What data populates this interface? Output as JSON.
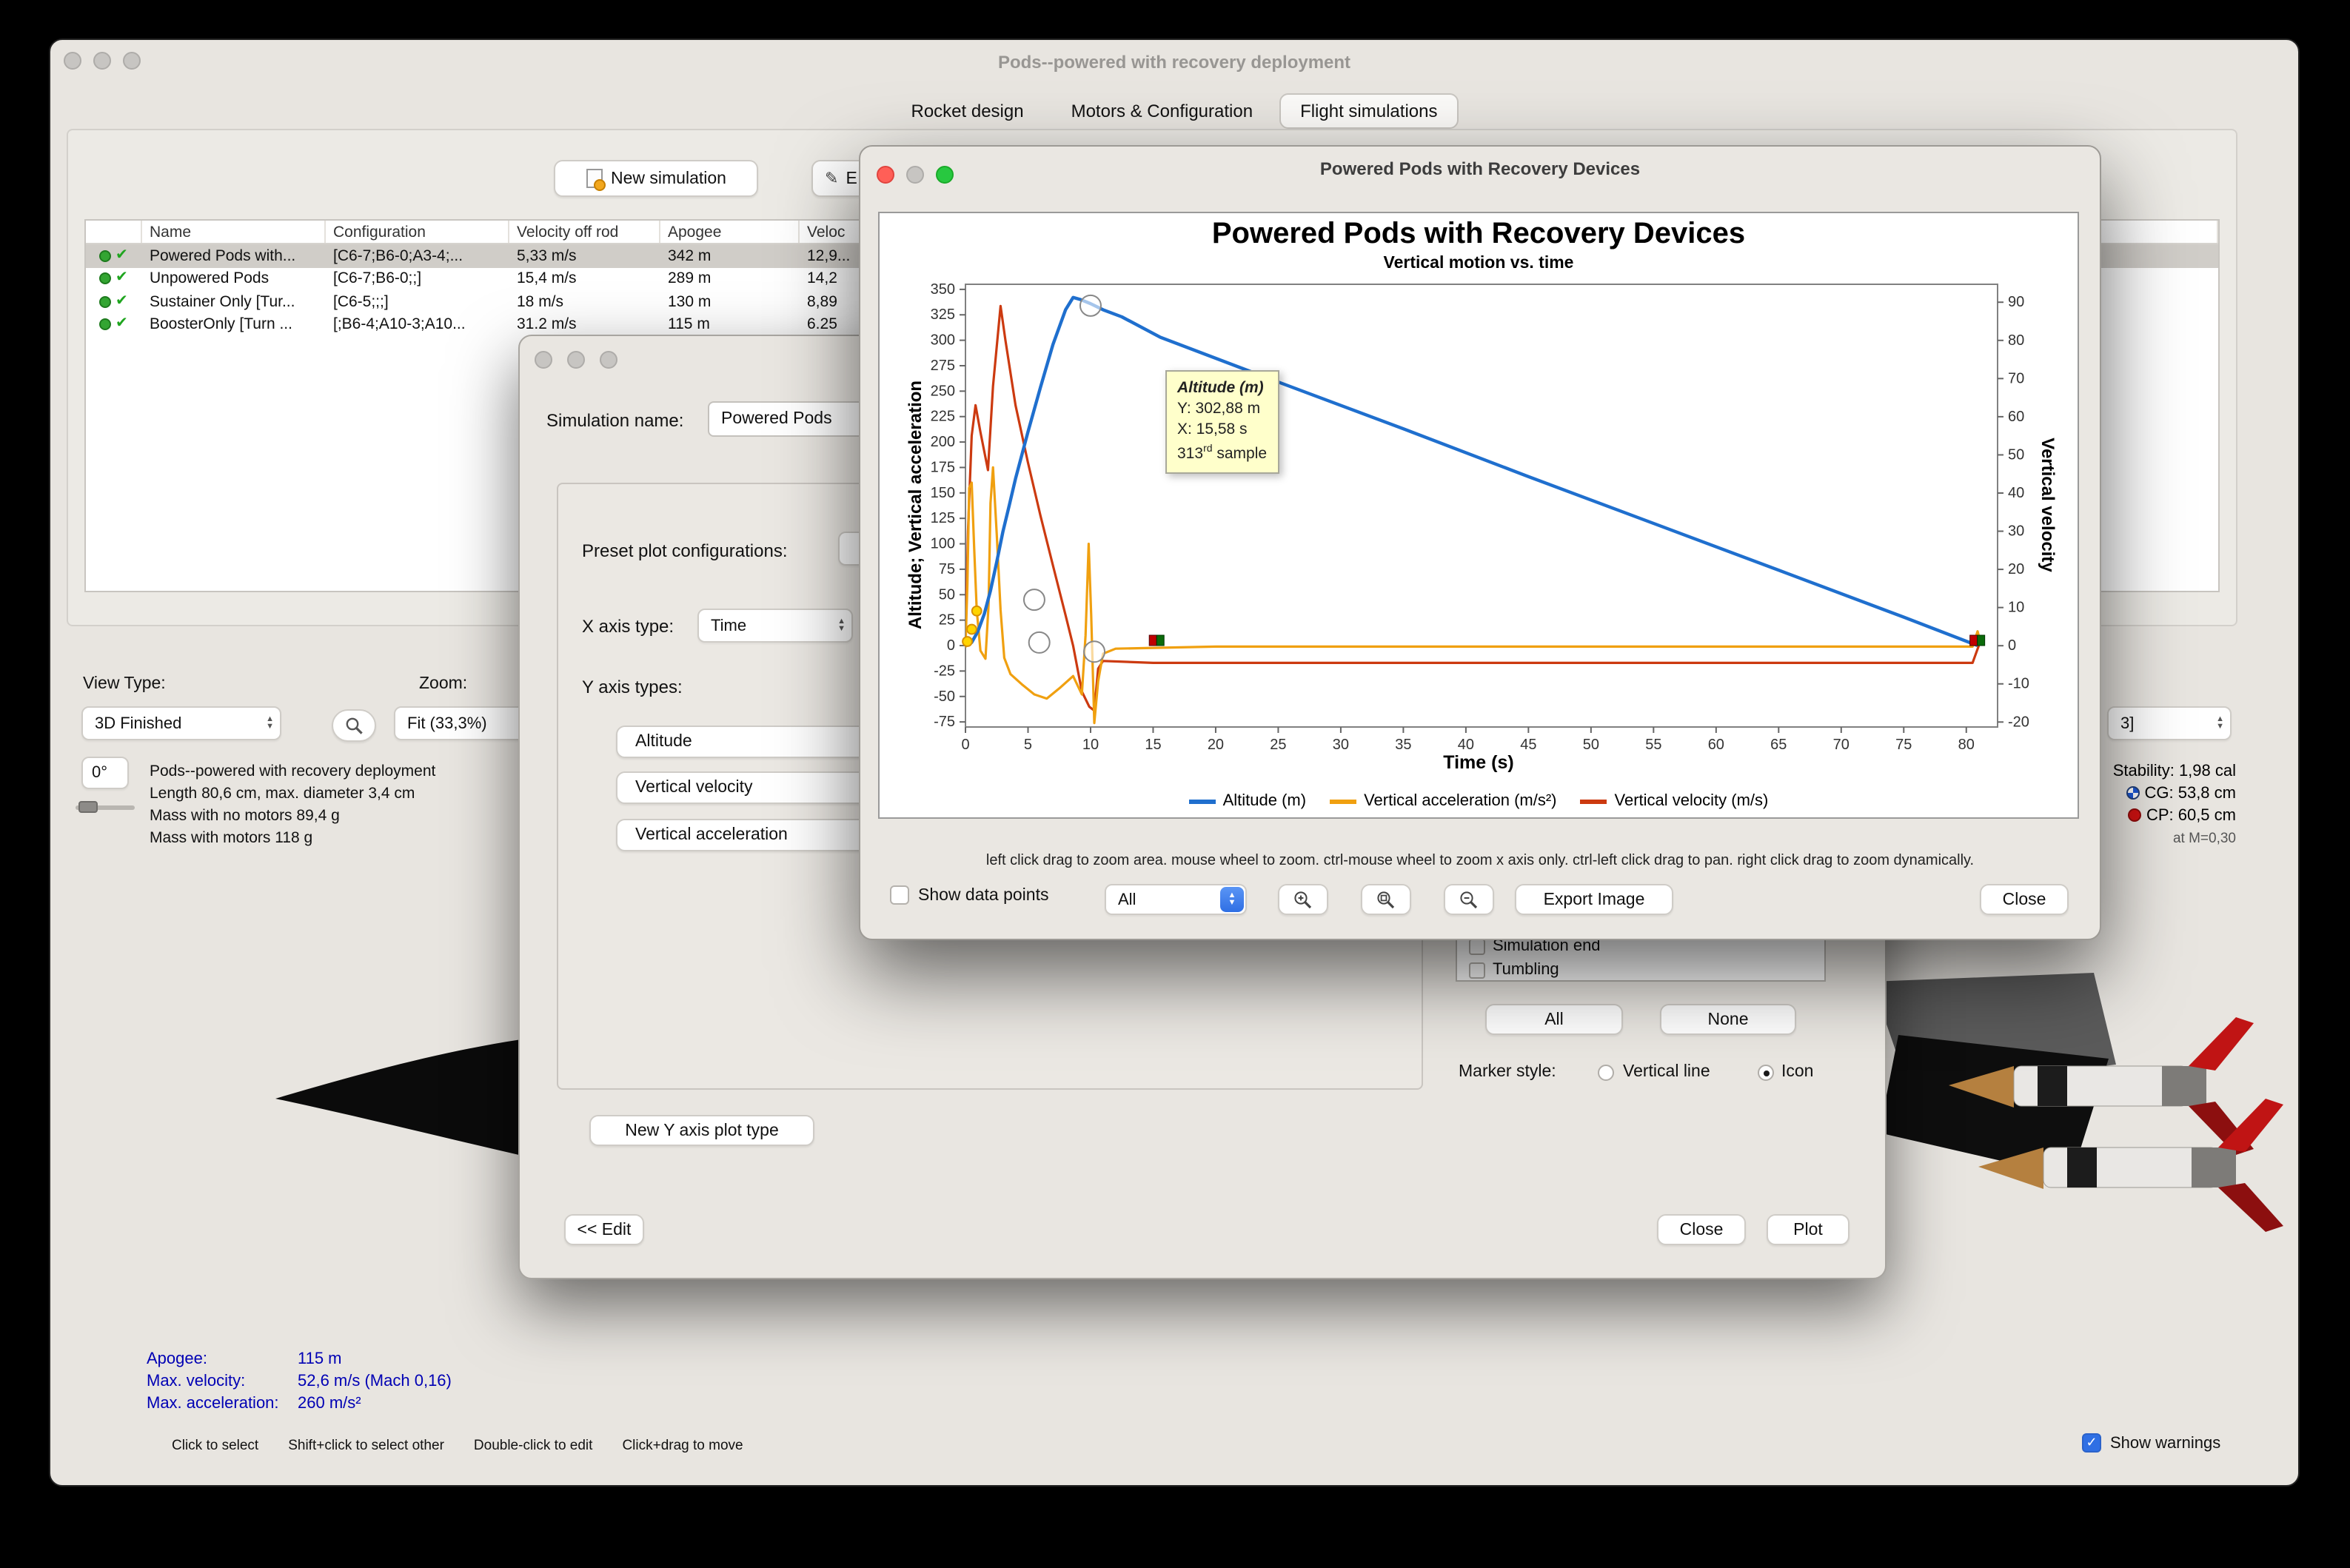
{
  "accent_colors": {
    "macos_blue": "#2f6fe4",
    "selection_gray": "#d0cdc8"
  },
  "main_window": {
    "title": "Pods--powered with recovery deployment",
    "tabs": [
      {
        "label": "Rocket design"
      },
      {
        "label": "Motors & Configuration"
      },
      {
        "label": "Flight simulations"
      }
    ],
    "toolbar": {
      "new_simulation": "New simulation",
      "edit_partial": "E"
    },
    "table": {
      "columns": [
        "Name",
        "Configuration",
        "Velocity off rod",
        "Apogee",
        "Veloc"
      ],
      "rows": [
        {
          "name": "Powered Pods with...",
          "configuration": "[C6-7;B6-0;A3-4;...",
          "velocity_off_rod": "5,33 m/s",
          "apogee": "342 m",
          "velocity_deployment": "12,9..."
        },
        {
          "name": "Unpowered Pods",
          "configuration": "[C6-7;B6-0;;]",
          "velocity_off_rod": "15,4 m/s",
          "apogee": "289 m",
          "velocity_deployment": "14,2"
        },
        {
          "name": "Sustainer Only [Tur...",
          "configuration": "[C6-5;;;]",
          "velocity_off_rod": "18 m/s",
          "apogee": "130 m",
          "velocity_deployment": "8,89"
        },
        {
          "name": "BoosterOnly [Turn ...",
          "configuration": "[;B6-4;A10-3;A10...",
          "velocity_off_rod": "31.2 m/s",
          "apogee": "115 m",
          "velocity_deployment": "6.25"
        }
      ]
    },
    "view_controls": {
      "view_type_label": "View Type:",
      "view_type_value": "3D Finished",
      "zoom_label": "Zoom:",
      "zoom_value": "Fit (33,3%)",
      "angle_value": "0°"
    },
    "rocket_info": [
      "Pods--powered with recovery deployment",
      "Length 80,6 cm, max. diameter 3,4 cm",
      "Mass with no motors 89,4 g",
      "Mass with motors 118 g"
    ],
    "config_selector_value": "3]",
    "stability": {
      "stability": "Stability: 1,98 cal",
      "cg": "CG: 53,8 cm",
      "cp": "CP: 60,5 cm",
      "mach": "at M=0,30"
    },
    "flight_stats": [
      {
        "label": "Apogee:",
        "value": "115 m"
      },
      {
        "label": "Max. velocity:",
        "value": "52,6 m/s  (Mach 0,16)"
      },
      {
        "label": "Max. acceleration:",
        "value": "260 m/s²"
      }
    ],
    "status_hints": [
      "Click to select",
      "Shift+click to select other",
      "Double-click to edit",
      "Click+drag to move"
    ],
    "show_warnings_label": "Show warnings"
  },
  "edit_dialog": {
    "simulation_name_label": "Simulation name:",
    "simulation_name_value": "Powered Pods",
    "preset_label": "Preset plot configurations:",
    "x_axis_label": "X axis type:",
    "x_axis_value": "Time",
    "y_axis_label": "Y axis types:",
    "y_axis_types": [
      "Altitude",
      "Vertical velocity",
      "Vertical acceleration"
    ],
    "new_y_axis_button": "New Y axis plot type",
    "edit_button": "<< Edit",
    "close_button": "Close",
    "plot_button": "Plot",
    "event_items": [
      "Simulation end",
      "Tumbling"
    ],
    "all_button": "All",
    "none_button": "None",
    "marker_style_label": "Marker style:",
    "marker_vertical_line": "Vertical line",
    "marker_icon": "Icon"
  },
  "plot_dialog": {
    "title": "Powered Pods with Recovery Devices",
    "help_text": "left click drag to zoom area. mouse wheel to zoom. ctrl-mouse wheel to zoom x axis only. ctrl-left click drag to pan.  right click drag to zoom dynamically.",
    "show_data_points_label": "Show data points",
    "branch_value": "All",
    "export_button": "Export Image",
    "close_button": "Close",
    "tooltip": {
      "series": "Altitude (m)",
      "y_text": "Y: 302,88 m",
      "x_text": "X: 15,58 s",
      "sample_number": "313",
      "sample_ordinal": "rd",
      "sample_word": " sample"
    }
  },
  "chart_data": {
    "type": "line",
    "title": "Powered Pods with Recovery Devices",
    "subtitle": "Vertical motion vs. time",
    "xlabel": "Time (s)",
    "ylabel_left": "Altitude; Vertical acceleration",
    "ylabel_right": "Vertical velocity",
    "x_axis": {
      "min": 0,
      "max": 82.5,
      "ticks": [
        0,
        5,
        10,
        15,
        20,
        25,
        30,
        35,
        40,
        45,
        50,
        55,
        60,
        65,
        70,
        75,
        80
      ]
    },
    "left_axis": {
      "min": -80,
      "max": 355,
      "ticks": [
        -75,
        -50,
        -25,
        0,
        25,
        50,
        75,
        100,
        125,
        150,
        175,
        200,
        225,
        250,
        275,
        300,
        325,
        350
      ]
    },
    "right_axis": {
      "min": -21.3,
      "max": 94.7,
      "ticks": [
        -20,
        -10,
        0,
        10,
        20,
        30,
        40,
        50,
        60,
        70,
        80,
        90
      ]
    },
    "series": [
      {
        "name": "Altitude (m)",
        "color": "#1f6fce",
        "axis": "left",
        "stroke_width": 2.2,
        "points": [
          [
            0,
            0
          ],
          [
            0.5,
            3
          ],
          [
            1,
            14
          ],
          [
            1.5,
            31
          ],
          [
            2,
            54
          ],
          [
            2.5,
            82
          ],
          [
            3,
            112
          ],
          [
            3.5,
            138
          ],
          [
            4,
            164
          ],
          [
            5,
            210
          ],
          [
            6,
            254
          ],
          [
            7,
            296
          ],
          [
            8,
            330
          ],
          [
            8.6,
            342
          ],
          [
            9.2,
            340
          ],
          [
            10,
            336
          ],
          [
            11,
            330
          ],
          [
            12.5,
            323
          ],
          [
            15.58,
            302.88
          ],
          [
            25,
            259
          ],
          [
            35,
            213
          ],
          [
            45,
            166
          ],
          [
            55,
            120
          ],
          [
            65,
            74
          ],
          [
            75,
            28
          ],
          [
            80.9,
            0
          ]
        ]
      },
      {
        "name": "Vertical acceleration (m/s²)",
        "color": "#f0a010",
        "axis": "left",
        "stroke_width": 1.6,
        "points": [
          [
            0,
            -2
          ],
          [
            0.15,
            60
          ],
          [
            0.3,
            155
          ],
          [
            0.5,
            160
          ],
          [
            0.7,
            95
          ],
          [
            0.9,
            35
          ],
          [
            1.2,
            -5
          ],
          [
            1.6,
            -13
          ],
          [
            1.85,
            40
          ],
          [
            2.0,
            140
          ],
          [
            2.2,
            175
          ],
          [
            2.5,
            110
          ],
          [
            2.8,
            35
          ],
          [
            3.1,
            -12
          ],
          [
            3.6,
            -28
          ],
          [
            4.5,
            -38
          ],
          [
            5.5,
            -48
          ],
          [
            6.5,
            -52
          ],
          [
            7.5,
            -42
          ],
          [
            8.6,
            -30
          ],
          [
            9.3,
            -48
          ],
          [
            9.6,
            10
          ],
          [
            9.85,
            100
          ],
          [
            10.05,
            30
          ],
          [
            10.3,
            -76
          ],
          [
            10.6,
            -35
          ],
          [
            11,
            -8
          ],
          [
            12,
            -3
          ],
          [
            20,
            -1
          ],
          [
            40,
            -1
          ],
          [
            60,
            -1
          ],
          [
            80.5,
            -1
          ],
          [
            80.9,
            14
          ],
          [
            81.2,
            0
          ]
        ]
      },
      {
        "name": "Vertical velocity (m/s)",
        "color": "#cc3a10",
        "axis": "right",
        "stroke_width": 1.6,
        "points": [
          [
            0,
            0
          ],
          [
            0.2,
            30
          ],
          [
            0.5,
            55
          ],
          [
            0.8,
            63
          ],
          [
            1.2,
            56
          ],
          [
            1.8,
            46
          ],
          [
            2.2,
            68
          ],
          [
            2.8,
            89
          ],
          [
            3.2,
            80
          ],
          [
            4,
            63
          ],
          [
            5,
            48
          ],
          [
            6,
            34
          ],
          [
            7,
            21
          ],
          [
            8,
            8
          ],
          [
            8.6,
            0
          ],
          [
            9.3,
            -12
          ],
          [
            9.9,
            -16
          ],
          [
            10.3,
            -17
          ],
          [
            10.6,
            -6
          ],
          [
            11,
            -4
          ],
          [
            15,
            -4.5
          ],
          [
            30,
            -4.5
          ],
          [
            50,
            -4.5
          ],
          [
            70,
            -4.5
          ],
          [
            80.5,
            -4.5
          ],
          [
            81,
            0
          ]
        ]
      }
    ],
    "markers": [
      {
        "type": "circle",
        "axis": "left",
        "x": 10.0,
        "y": 334
      },
      {
        "type": "circle",
        "axis": "left",
        "x": 5.5,
        "y": 45
      },
      {
        "type": "circle",
        "axis": "left",
        "x": 5.9,
        "y": 3
      },
      {
        "type": "circle",
        "axis": "left",
        "x": 10.3,
        "y": -6
      },
      {
        "type": "flag",
        "axis": "left",
        "x": 15.4,
        "y": 0
      },
      {
        "type": "flag",
        "axis": "left",
        "x": 81,
        "y": 0
      },
      {
        "type": "burst",
        "axis": "left",
        "x": 0.15,
        "y": 4
      },
      {
        "type": "burst",
        "axis": "left",
        "x": 0.5,
        "y": 16
      },
      {
        "type": "burst",
        "axis": "left",
        "x": 0.9,
        "y": 34
      }
    ],
    "legend": [
      {
        "label": "Altitude (m)",
        "color": "#1f6fce"
      },
      {
        "label": "Vertical acceleration (m/s²)",
        "color": "#f0a010"
      },
      {
        "label": "Vertical velocity (m/s)",
        "color": "#cc3a10"
      }
    ]
  }
}
